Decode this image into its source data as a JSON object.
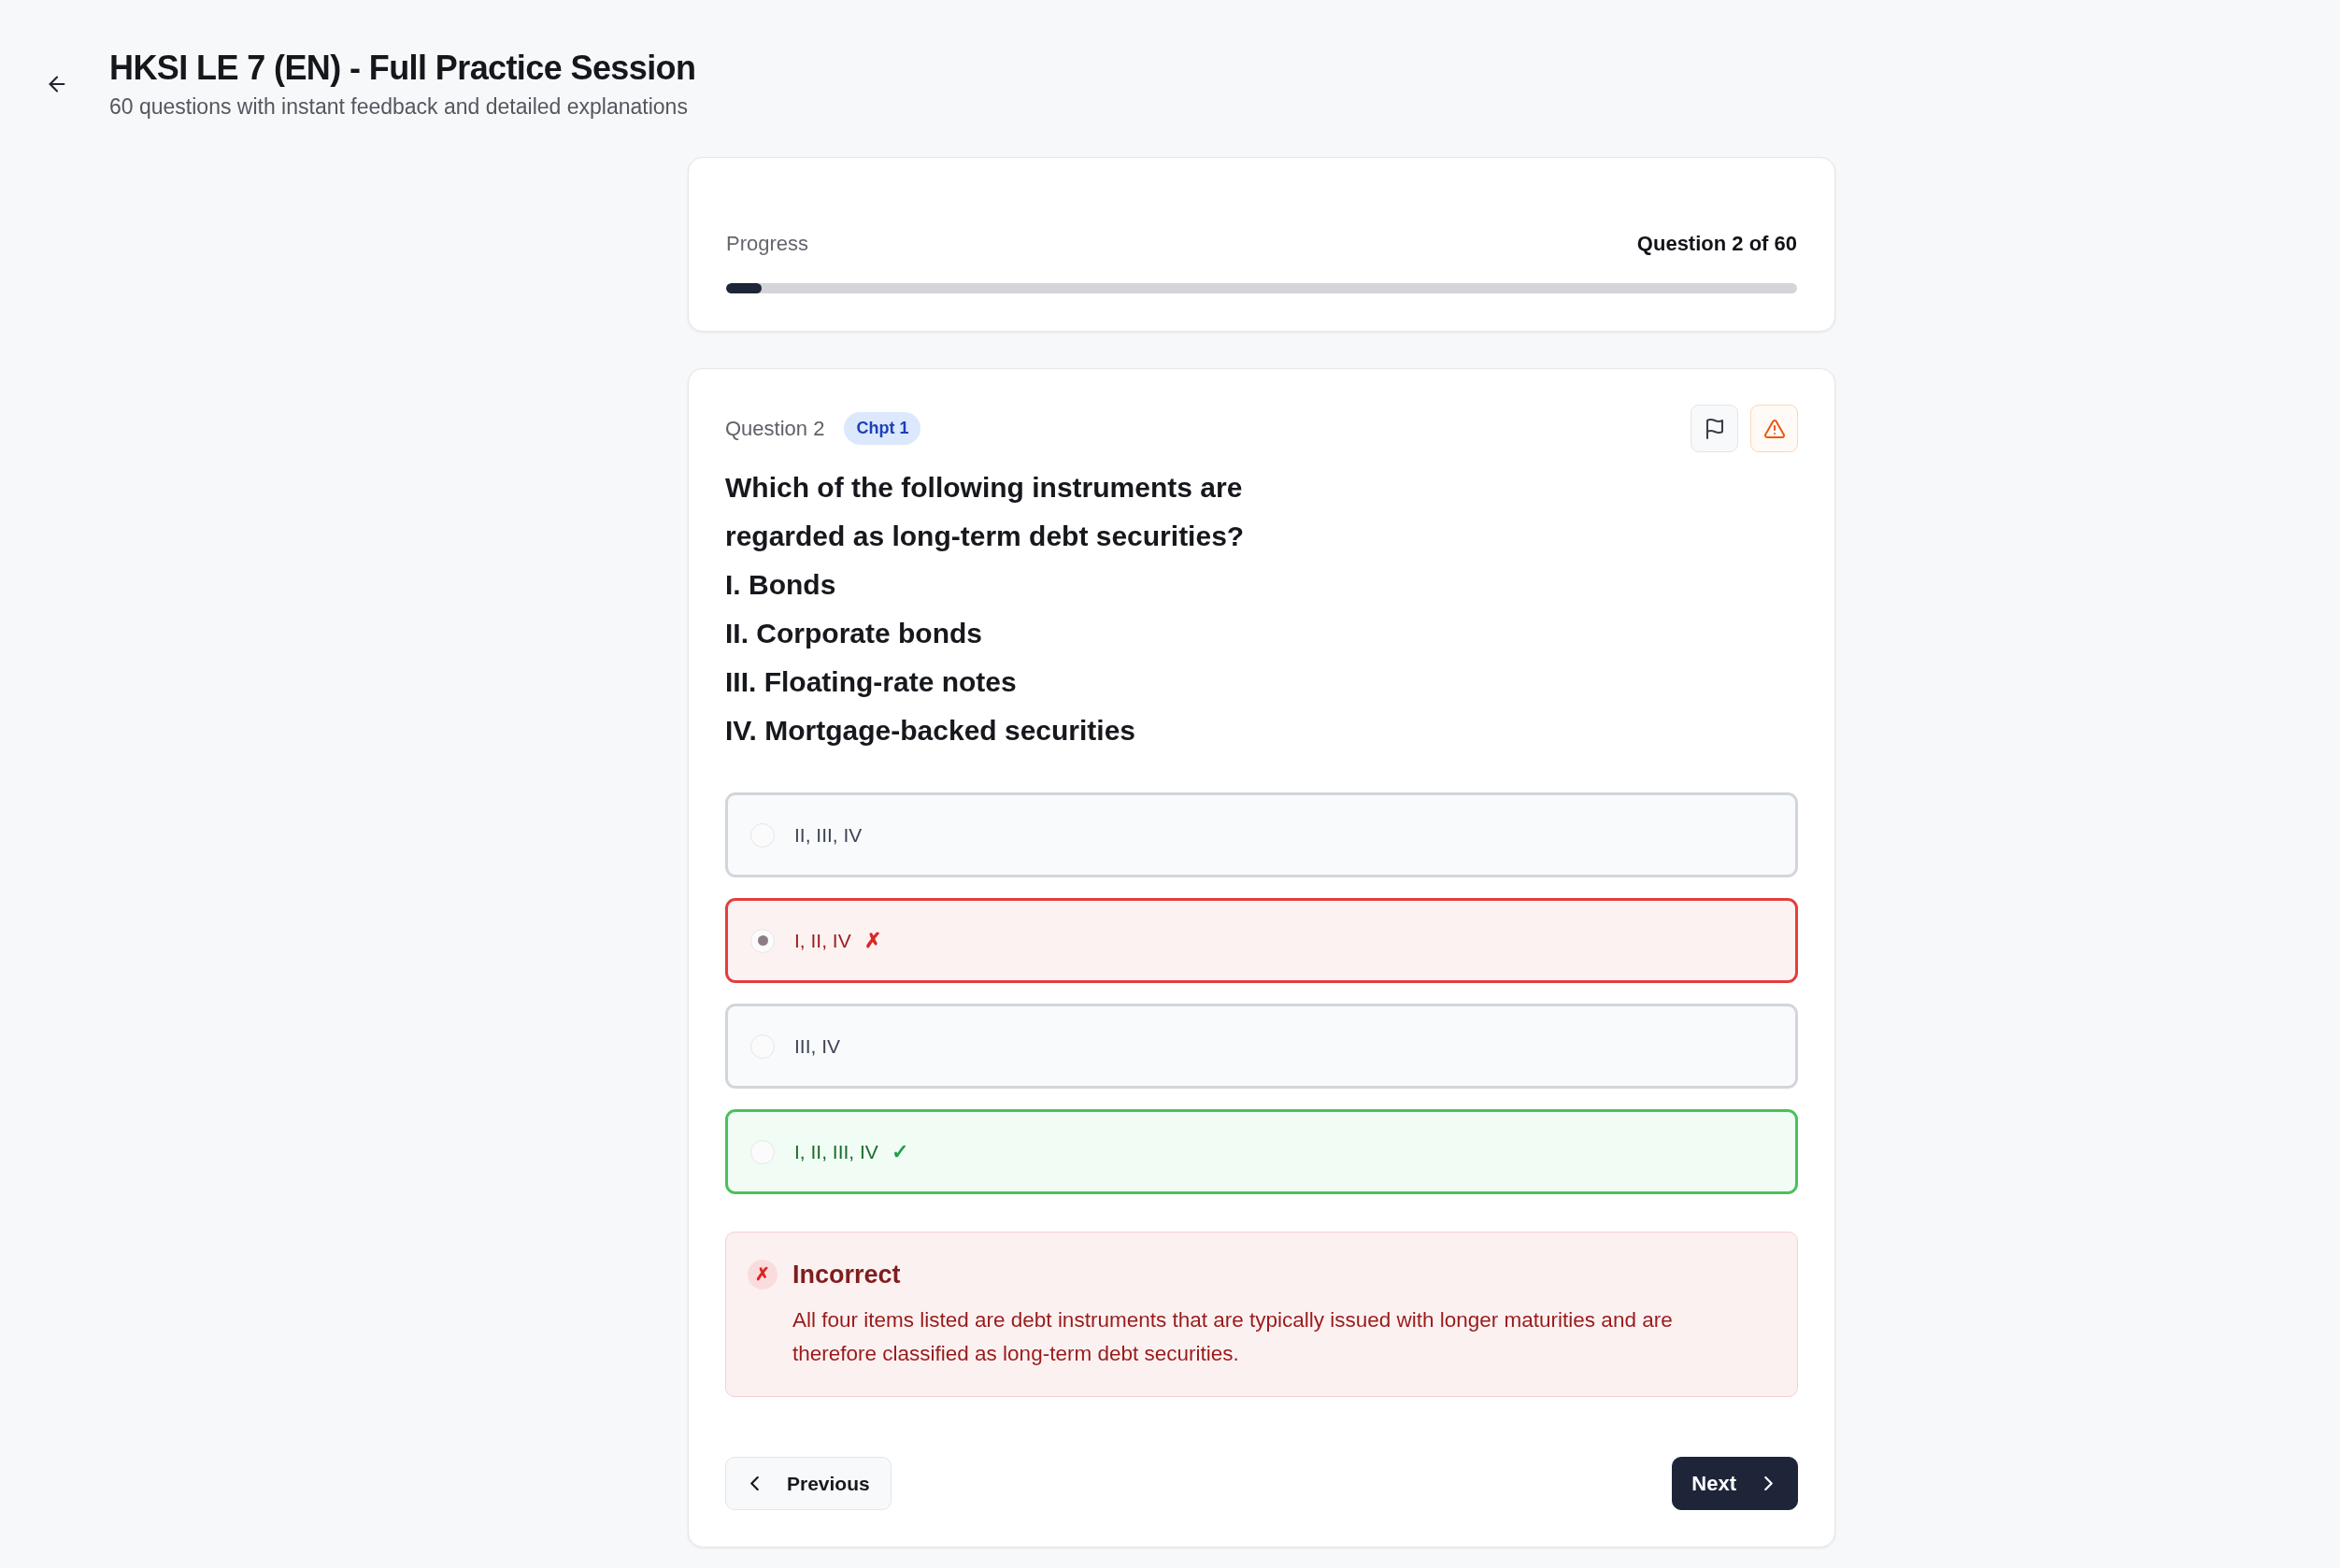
{
  "header": {
    "title": "HKSI LE 7 (EN) - Full Practice Session",
    "subtitle": "60 questions with instant feedback and detailed explanations"
  },
  "progress": {
    "label": "Progress",
    "counter": "Question 2 of 60",
    "level": 0.0333
  },
  "question": {
    "label": "Question 2",
    "chapter": "Chpt 1",
    "stem": "Which of the following instruments are regarded as long-term debt securities?",
    "statements": [
      "I. Bonds",
      "II. Corporate bonds",
      "III. Floating-rate notes",
      "IV. Mortgage-backed securities"
    ],
    "options": [
      {
        "text": "II, III, IV",
        "selected": false,
        "correct": false
      },
      {
        "text": "I, II, IV",
        "selected": true,
        "correct": false,
        "mark": "✗"
      },
      {
        "text": "III, IV",
        "selected": false,
        "correct": false
      },
      {
        "text": "I, II, III, IV",
        "selected": false,
        "correct": true,
        "mark": "✓"
      }
    ]
  },
  "feedback": {
    "kind": "incorrect",
    "mark": "✗",
    "title": "Incorrect",
    "message": "All four items listed are debt instruments that are typically issued with longer maturities and are therefore classified as long-term debt securities."
  },
  "navigation": {
    "previous": "Previous",
    "next": "Next"
  }
}
